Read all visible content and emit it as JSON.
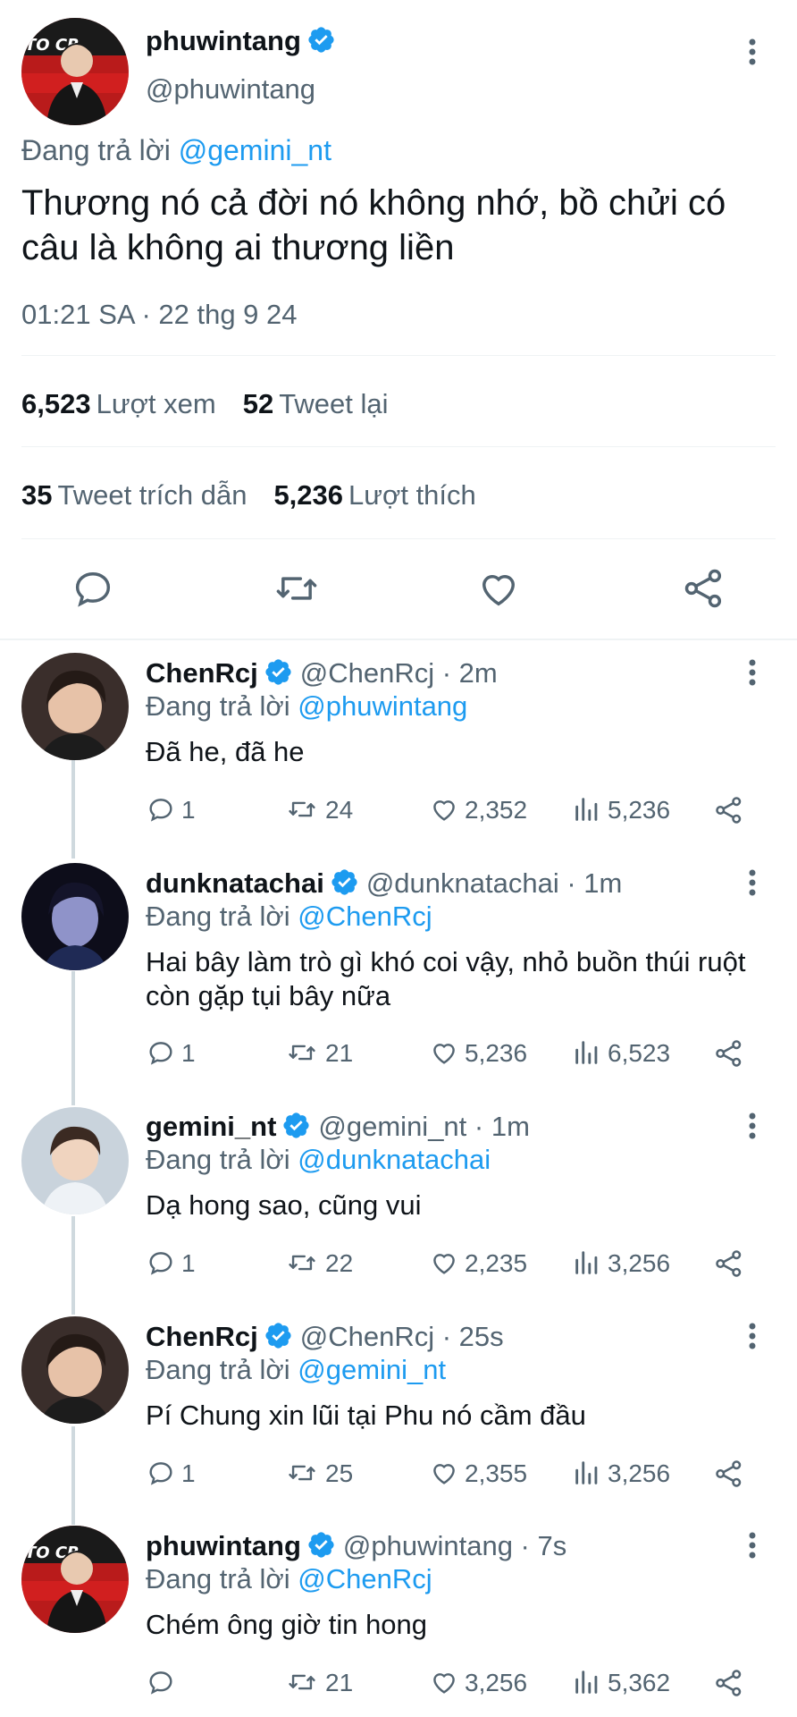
{
  "main": {
    "name": "phuwintang",
    "handle": "@phuwintang",
    "replying_prefix": "Đang trả lời",
    "replying_to": "@gemini_nt",
    "text": "Thương nó cả đời nó không nhớ, bồ chửi có câu là không ai thương liền",
    "timestamp": "01:21 SA · 22 thg 9 24",
    "views_count": "6,523",
    "views_label": "Lượt xem",
    "retweets_count": "52",
    "retweets_label": "Tweet lại",
    "quotes_count": "35",
    "quotes_label": "Tweet trích dẫn",
    "likes_count": "5,236",
    "likes_label": "Lượt thích"
  },
  "replies": [
    {
      "name": "ChenRcj",
      "handle": "@ChenRcj · 2m",
      "replying_prefix": "Đang trả lời",
      "replying_to": "@phuwintang",
      "text": "Đã he, đã he",
      "replies": "1",
      "retweets": "24",
      "likes": "2,352",
      "views": "5,236"
    },
    {
      "name": "dunknatachai",
      "handle": "@dunknatachai · 1m",
      "replying_prefix": "Đang trả lời",
      "replying_to": "@ChenRcj",
      "text": "Hai bây làm trò gì khó coi vậy, nhỏ buồn thúi ruột còn gặp tụi bây nữa",
      "replies": "1",
      "retweets": "21",
      "likes": "5,236",
      "views": "6,523"
    },
    {
      "name": "gemini_nt",
      "handle": "@gemini_nt · 1m",
      "replying_prefix": "Đang trả lời",
      "replying_to": "@dunknatachai",
      "text": "Dạ hong sao, cũng vui",
      "replies": "1",
      "retweets": "22",
      "likes": "2,235",
      "views": "3,256"
    },
    {
      "name": "ChenRcj",
      "handle": "@ChenRcj · 25s",
      "replying_prefix": "Đang trả lời",
      "replying_to": "@gemini_nt",
      "text": "Pí Chung xin lũi tại Phu nó cầm đầu",
      "replies": "1",
      "retweets": "25",
      "likes": "2,355",
      "views": "3,256"
    },
    {
      "name": "phuwintang",
      "handle": "@phuwintang · 7s",
      "replying_prefix": "Đang trả lời",
      "replying_to": "@ChenRcj",
      "text": "Chém ông giờ tin hong",
      "replies": "",
      "retweets": "21",
      "likes": "3,256",
      "views": "5,362"
    }
  ],
  "avatar_logo_text": "TO CR"
}
